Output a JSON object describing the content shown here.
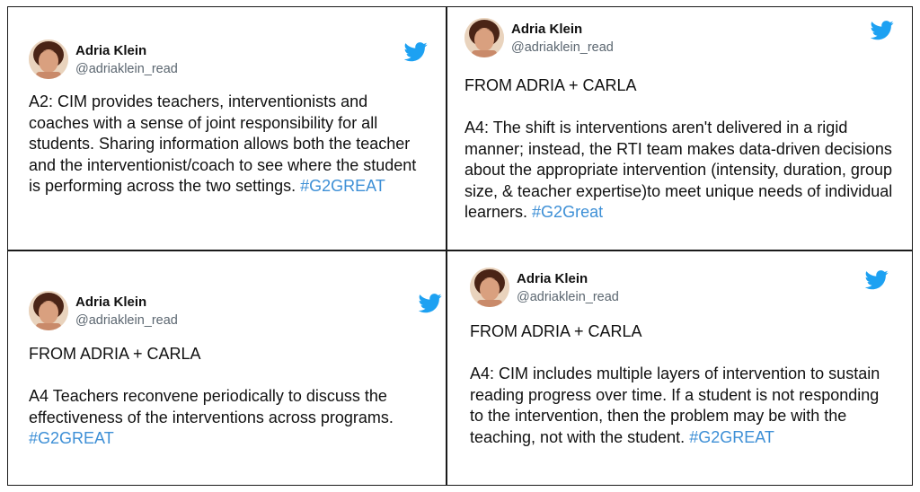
{
  "colors": {
    "border": "#1a1a1a",
    "hashtag": "#3d8fd6",
    "twitter_bird": "#1da1f2",
    "handle": "#5b6670"
  },
  "icons": {
    "avatar": "avatar-photo",
    "bird": "twitter-bird-icon"
  },
  "tweets": [
    {
      "author": "Adria Klein",
      "handle": "@adriaklein_read",
      "header": "",
      "text": "A2: CIM provides teachers, interventionists and coaches with a sense of joint responsibility for all students. Sharing information allows both the teacher and the interventionist/coach to see where the student is performing across the two settings.",
      "hashtag": "#G2GREAT"
    },
    {
      "author": "Adria Klein",
      "handle": "@adriaklein_read",
      "header": "FROM ADRIA + CARLA",
      "text": "A4:  The shift is interventions aren't delivered in a rigid manner; instead, the RTI team makes data-driven decisions about the appropriate intervention (intensity, duration, group size, & teacher expertise)to meet unique needs of individual learners.",
      "hashtag": "#G2Great"
    },
    {
      "author": "Adria Klein",
      "handle": "@adriaklein_read",
      "header": "FROM ADRIA + CARLA",
      "text": "A4 Teachers reconvene periodically to discuss the effectiveness of the interventions across programs.",
      "hashtag": "#G2GREAT"
    },
    {
      "author": "Adria Klein",
      "handle": "@adriaklein_read",
      "header": "FROM ADRIA + CARLA",
      "text": "A4: CIM includes multiple layers of intervention to sustain reading progress over time. If a student is not responding to the intervention, then the problem may be with the teaching, not with the student.",
      "hashtag": "#G2GREAT"
    }
  ]
}
